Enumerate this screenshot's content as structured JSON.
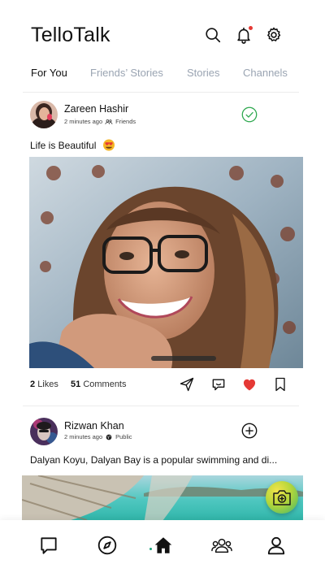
{
  "app": {
    "title": "TelloTalk"
  },
  "header": {
    "icons": [
      "search-icon",
      "bell-icon",
      "gear-icon"
    ],
    "has_notification": true
  },
  "tabs": [
    {
      "label": "For You",
      "active": true
    },
    {
      "label": "Friends’ Stories",
      "active": false
    },
    {
      "label": "Stories",
      "active": false
    },
    {
      "label": "Channels",
      "active": false
    }
  ],
  "posts": [
    {
      "author": "Zareen Hashir",
      "time": "2 minutes ago",
      "audience": "Friends",
      "audience_icon": "friends-icon",
      "caption": "Life is Beautiful",
      "caption_emoji": "heart-eyes-emoji",
      "follow_status_icon": "check-circle-icon",
      "likes_count": "2",
      "likes_label": "Likes",
      "comments_count": "51",
      "comments_label": "Comments",
      "liked": true,
      "actions": [
        "send-icon",
        "comment-icon",
        "heart-icon",
        "bookmark-icon"
      ]
    },
    {
      "author": "Rizwan Khan",
      "time": "2 minutes ago",
      "audience": "Public",
      "audience_icon": "globe-icon",
      "caption": "Dalyan Koyu, Dalyan Bay is a popular swimming and di...",
      "follow_action_icon": "add-circle-icon"
    }
  ],
  "fab": {
    "icon": "add-photo-icon"
  },
  "bottom_nav": {
    "items": [
      "chat-icon",
      "explore-icon",
      "home-icon",
      "groups-icon",
      "profile-icon"
    ],
    "active": "home-icon"
  },
  "colors": {
    "accent_green": "#2ea84f",
    "like_red": "#e53935",
    "tab_inactive": "#9aa4b2"
  }
}
